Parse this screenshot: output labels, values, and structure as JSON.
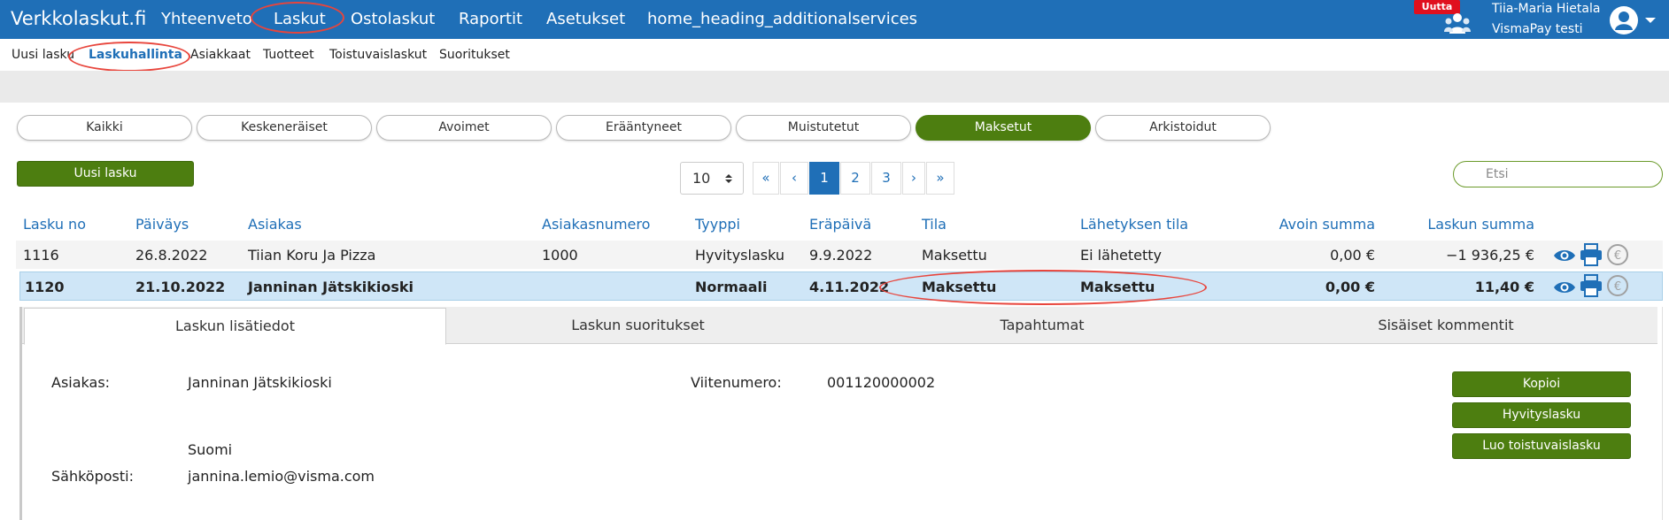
{
  "app": {
    "brand": "Verkkolaskut.fi"
  },
  "topnav": {
    "items": [
      "Yhteenveto",
      "Laskut",
      "Ostolaskut",
      "Raportit",
      "Asetukset",
      "home_heading_additionalservices"
    ],
    "active": "Laskut"
  },
  "user": {
    "badge": "Uutta",
    "name": "Tiia-Maria Hietala",
    "company": "VismaPay testi"
  },
  "subnav": {
    "items": [
      "Uusi lasku",
      "Laskuhallinta",
      "Asiakkaat",
      "Tuotteet",
      "Toistuvaislaskut",
      "Suoritukset"
    ],
    "active": "Laskuhallinta"
  },
  "filters": {
    "items": [
      "Kaikki",
      "Keskeneräiset",
      "Avoimet",
      "Erääntyneet",
      "Muistutetut",
      "Maksetut",
      "Arkistoidut"
    ],
    "active": "Maksetut"
  },
  "controls": {
    "new_invoice": "Uusi lasku",
    "per_page": "10",
    "pager": [
      "«",
      "‹",
      "1",
      "2",
      "3",
      "›",
      "»"
    ],
    "current_page": "1",
    "search_placeholder": "Etsi"
  },
  "table": {
    "columns": [
      "Lasku no",
      "Päiväys",
      "Asiakas",
      "Asiakasnumero",
      "Tyyppi",
      "Eräpäivä",
      "Tila",
      "Lähetyksen tila",
      "Avoin summa",
      "Laskun summa"
    ],
    "rows": [
      [
        "1116",
        "26.8.2022",
        "Tiian Koru Ja Pizza",
        "1000",
        "Hyvityslasku",
        "9.9.2022",
        "Maksettu",
        "Ei lähetetty",
        "0,00 €",
        "−1 936,25 €"
      ],
      [
        "1120",
        "21.10.2022",
        "Janninan Jätskikioski",
        "",
        "Normaali",
        "4.11.2022",
        "Maksettu",
        "Maksettu",
        "0,00 €",
        "11,40 €"
      ]
    ],
    "row_icons": [
      "eye-icon",
      "print-icon",
      "euro-icon"
    ]
  },
  "detail": {
    "tabs": [
      "Laskun lisätiedot",
      "Laskun suoritukset",
      "Tapahtumat",
      "Sisäiset kommentit"
    ],
    "active_tab": "Laskun lisätiedot",
    "customer_label": "Asiakas:",
    "customer_value": "Janninan Jätskikioski",
    "reference_label": "Viitenumero:",
    "reference_value": "001120000002",
    "country": "Suomi",
    "email_label": "Sähköposti:",
    "email_value": "jannina.lemio@visma.com",
    "actions": [
      "Kopioi",
      "Hyvityslasku",
      "Luo toistuvaislasku"
    ]
  },
  "colors": {
    "nav_blue": "#1f6fb7",
    "accent_green": "#4d7e10",
    "highlight_red": "#e8453c",
    "selected_row": "#cfe6f7"
  }
}
